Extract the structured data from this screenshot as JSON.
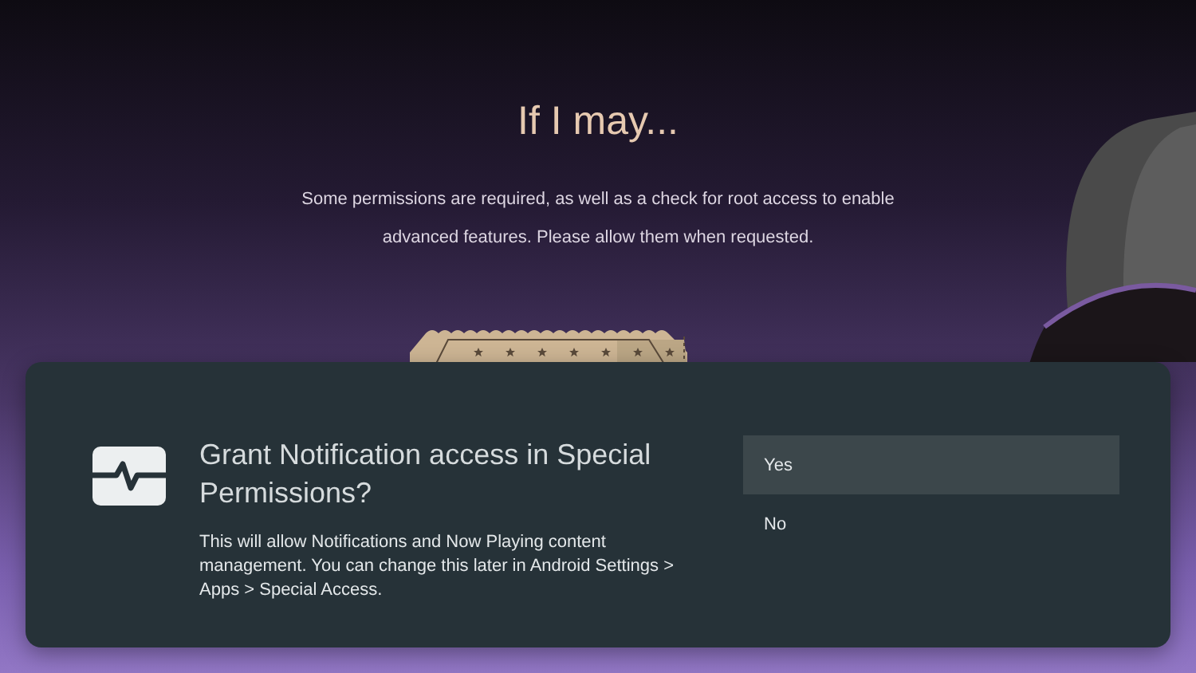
{
  "heading": "If I may...",
  "intro": "Some permissions are required, as well as a check for root access to enable advanced features. Please allow them when requested.",
  "dialog": {
    "title": "Grant Notification access in Special Permissions?",
    "message": "This will allow Notifications and Now Playing content management. You can change this later in Android Settings > Apps > Special Access.",
    "options": [
      {
        "label": "Yes",
        "selected": true
      },
      {
        "label": "No",
        "selected": false
      }
    ]
  }
}
